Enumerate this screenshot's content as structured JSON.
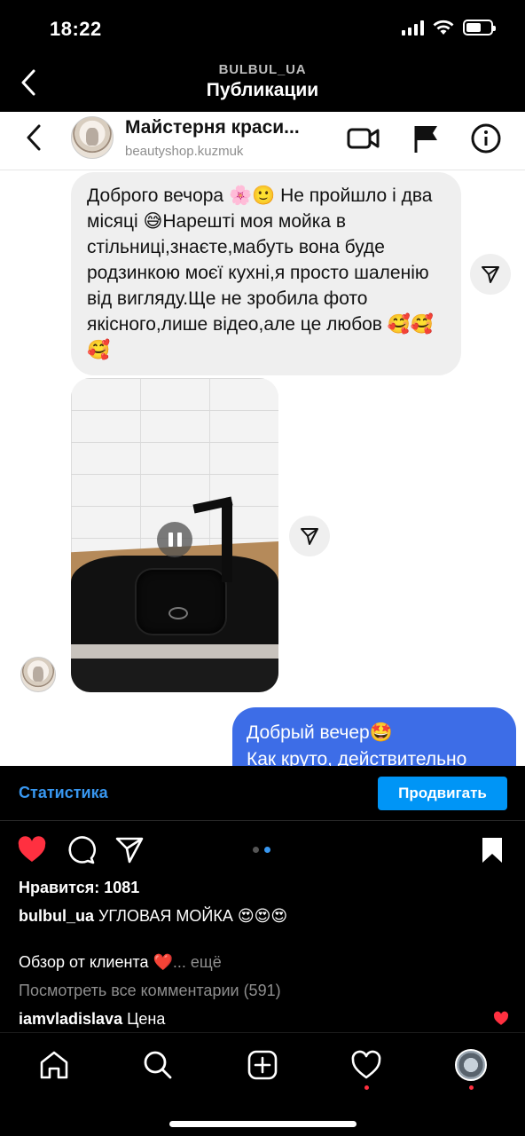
{
  "status_bar": {
    "time": "18:22",
    "battery_level": 0.6
  },
  "header": {
    "account": "BULBUL_UA",
    "title": "Публикации",
    "back_icon": "chevron-left-icon"
  },
  "chat": {
    "name": "Майстерня краси...",
    "username": "beautyshop.kuzmuk",
    "incoming_message": "Доброго вечора 🌸🙂 Не пройшло і два місяці 😅Нарешті моя мойка в стільниці,знаєте,мабуть вона буде родзинкою моєї кухні,я просто шаленію від вигляду.Ще не зробила фото якісного,лише відео,але це любов 🥰🥰🥰",
    "outgoing_message_line1": "Добрый вечер🤩",
    "outgoing_message_line2": "Как круто, действительно",
    "colors": {
      "outgoing_bubble": "#3d6de7",
      "incoming_bubble": "#efefef"
    }
  },
  "post": {
    "stats_link": "Статистика",
    "promote_button": "Продвигать",
    "likes": "Нравится: 1081",
    "caption_user": "bulbul_ua",
    "caption_text": " УГЛОВАЯ МОЙКА 😍😍😍",
    "caption_line2": "Обзор от клиента ❤️",
    "caption_more": "... ещё",
    "view_comments": "Посмотреть все комментарии (591)",
    "comment_user": "iamvladislava",
    "comment_text": " Цена",
    "carousel": {
      "count": 2,
      "active": 1
    },
    "colors": {
      "like_red": "#ff3040",
      "link_blue": "#3897f0",
      "button_blue": "#0095f6"
    }
  },
  "nav": {
    "items": [
      "home-icon",
      "search-icon",
      "new-post-icon",
      "activity-heart-icon",
      "profile-avatar"
    ]
  }
}
